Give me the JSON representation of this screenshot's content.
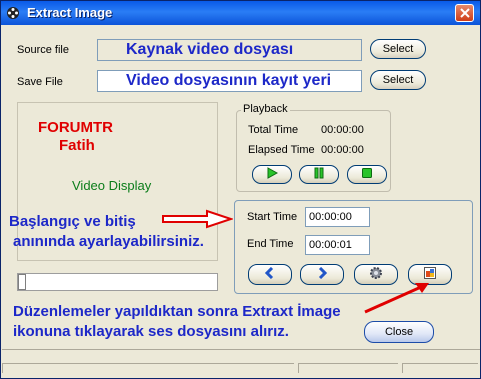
{
  "window": {
    "title": "Extract Image"
  },
  "source": {
    "label": "Source file",
    "value": "Kaynak video dosyası",
    "button": "Select"
  },
  "save": {
    "label": "Save File",
    "value": "Video dosyasının kayıt yeri",
    "button": "Select"
  },
  "video": {
    "annot_title": "FORUMTR",
    "annot_name": "Fatih",
    "display_label": "Video Display"
  },
  "playback": {
    "legend": "Playback",
    "total_label": "Total Time",
    "total_value": "00:00:00",
    "elapsed_label": "Elapsed Time",
    "elapsed_value": "00:00:00"
  },
  "range": {
    "start_label": "Start Time",
    "start_value": "00:00:00",
    "end_label": "End  Time",
    "end_value": "00:00:01"
  },
  "annotations": {
    "left_line1": "Başlangıç ve bitiş",
    "left_line2": "anınında ayarlayabilirsiniz.",
    "bottom_line1": "Düzenlemeler yapıldıktan sonra Extraxt İmage",
    "bottom_line2": "ikonuna tıklayarak ses dosyasını alırız."
  },
  "close_button": "Close",
  "slider": {
    "position": 0
  },
  "colors": {
    "title_bar": "#0a5ae8",
    "annotation_red": "#e00000",
    "annotation_blue": "#1d28c8",
    "play_green": "#29c42a",
    "nav_blue": "#2156c8"
  },
  "icons": [
    "film-reel-icon",
    "close-x-icon",
    "play-icon",
    "pause-icon",
    "stop-icon",
    "rewind-icon",
    "forward-icon",
    "gear-icon",
    "extract-image-icon"
  ]
}
